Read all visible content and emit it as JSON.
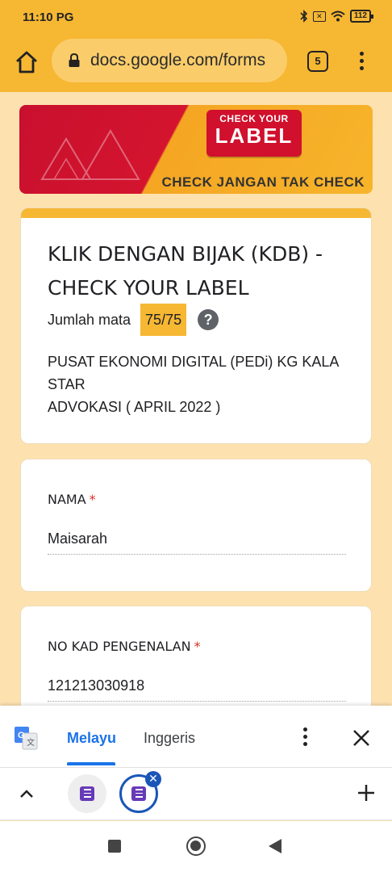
{
  "status_bar": {
    "time": "11:10 PG",
    "battery": "112",
    "icons": [
      "bluetooth-icon",
      "sim-off-icon",
      "wifi-icon",
      "battery-icon"
    ]
  },
  "browser": {
    "url": "docs.google.com/forms",
    "tab_count": "5",
    "icons": [
      "home-icon",
      "lock-icon",
      "tabs-icon",
      "more-vert-icon"
    ]
  },
  "banner": {
    "check_your": "CHECK YOUR",
    "label": "LABEL",
    "slogan": "CHECK JANGAN TAK CHECK"
  },
  "form": {
    "title": "KLIK DENGAN BIJAK (KDB) - CHECK YOUR LABEL",
    "score_label": "Jumlah mata",
    "score_value": "75/75",
    "description_line1": "PUSAT EKONOMI DIGITAL (PEDi) KG KALA STAR",
    "description_line2": "ADVOKASI ( APRIL 2022 )",
    "questions": [
      {
        "label": "NAMA",
        "required_mark": "*",
        "answer": "Maisarah"
      },
      {
        "label": "NO KAD PENGENALAN",
        "required_mark": "*",
        "answer": "121213030918"
      }
    ]
  },
  "translate_bar": {
    "languages": [
      "Melayu",
      "Inggeris"
    ],
    "active_language": "Melayu"
  },
  "colors": {
    "accent": "#f6b733",
    "page_bg": "#fde2b0",
    "link_blue": "#1a73e8",
    "required_red": "#d93025"
  }
}
